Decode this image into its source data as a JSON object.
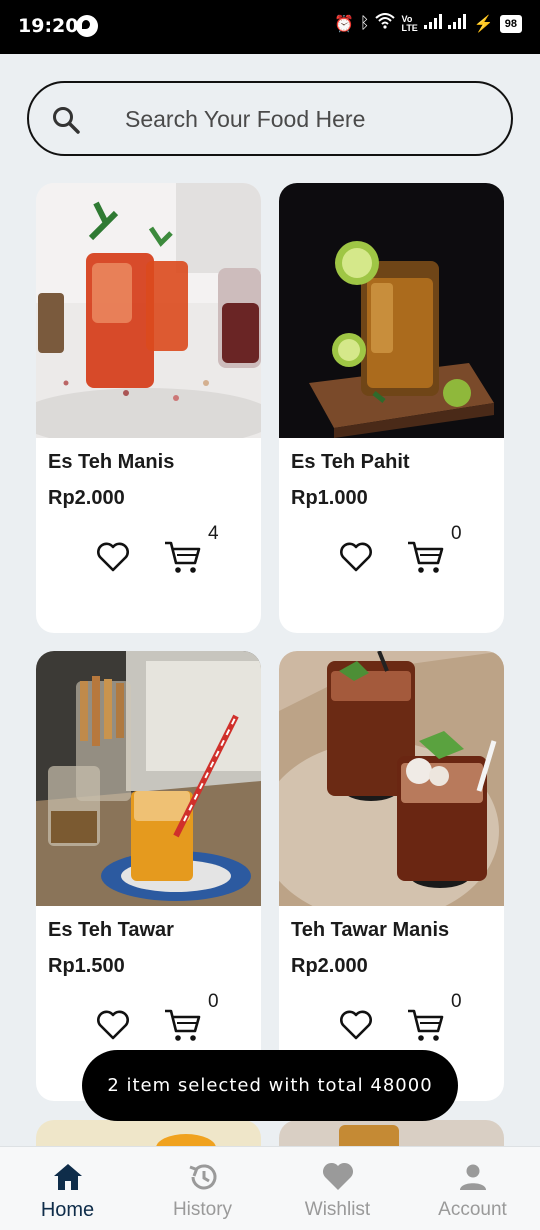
{
  "status_bar": {
    "time": "19:20",
    "battery": "98"
  },
  "search": {
    "placeholder": "Search Your Food Here"
  },
  "products": [
    {
      "name": "Es Teh Manis",
      "price": "Rp2.000",
      "cart_count": "4"
    },
    {
      "name": "Es Teh Pahit",
      "price": "Rp1.000",
      "cart_count": "0"
    },
    {
      "name": "Es Teh Tawar",
      "price": "Rp1.500",
      "cart_count": "0"
    },
    {
      "name": "Teh Tawar Manis",
      "price": "Rp2.000",
      "cart_count": "0"
    }
  ],
  "toast": {
    "text": "2 item selected with total 48000"
  },
  "nav": {
    "items": [
      {
        "label": "Home",
        "icon": "home-icon",
        "active": true
      },
      {
        "label": "History",
        "icon": "history-icon",
        "active": false
      },
      {
        "label": "Wishlist",
        "icon": "heart-icon",
        "active": false
      },
      {
        "label": "Account",
        "icon": "person-icon",
        "active": false
      }
    ]
  },
  "colors": {
    "background": "#ebeff2",
    "nav_active": "#0f2d4a",
    "nav_inactive": "#9a9a9a",
    "toast_bg": "#000000"
  }
}
